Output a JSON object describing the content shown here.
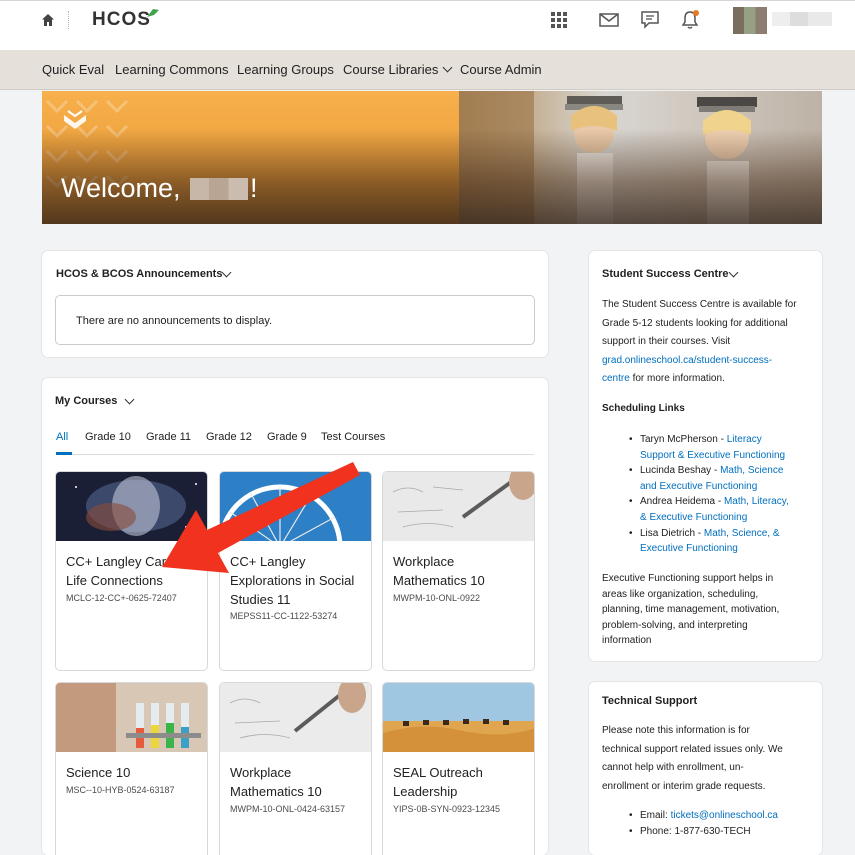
{
  "header": {
    "logo_text": "HCOS",
    "icons": [
      "home-icon",
      "grid-icon",
      "mail-icon",
      "chat-icon",
      "bell-icon"
    ],
    "notification_dot_color": "#e87722"
  },
  "nav": {
    "items": [
      "Quick Eval",
      "Learning Commons",
      "Learning Groups",
      "Course Libraries",
      "Course Admin"
    ]
  },
  "banner": {
    "welcome_prefix": "Welcome, ",
    "welcome_suffix": "!"
  },
  "announcements": {
    "title": "HCOS & BCOS Announcements",
    "empty_text": "There are no announcements to display."
  },
  "my_courses": {
    "title": "My Courses",
    "tabs": [
      "All",
      "Grade 10",
      "Grade 11",
      "Grade 12",
      "Grade 9",
      "Test Courses"
    ],
    "active_tab": "All",
    "courses": [
      {
        "title": "CC+ Langley Career Life Connections",
        "code": "MCLC-12-CC+-0625-72407",
        "image": "galaxy-image"
      },
      {
        "title": "CC+ Langley Explorations in Social Studies 11",
        "code": "MEPSS11-CC-1122-53274",
        "image": "ferris-wheel-image"
      },
      {
        "title": "Workplace Mathematics 10",
        "code": "MWPM-10-ONL-0922",
        "image": "math-worksheet-image"
      },
      {
        "title": "Science 10",
        "code": "MSC--10-HYB-0524-63187",
        "image": "lab-tubes-image"
      },
      {
        "title": "Workplace Mathematics 10",
        "code": "MWPM-10-ONL-0424-63157",
        "image": "math-worksheet-image"
      },
      {
        "title": "SEAL Outreach Leadership",
        "code": "YIPS-0B-SYN-0923-12345",
        "image": "desert-camels-image"
      }
    ]
  },
  "student_success": {
    "title": "Student Success Centre",
    "intro_1": "The Student Success Centre is available for",
    "intro_2": "Grade 5-12 students looking for additional",
    "intro_3": "support in their courses.  Visit",
    "link_1": "grad.onlineschool.ca/student-success-",
    "link_2": "centre",
    "link_suffix": " for more information.",
    "scheduling_title": "Scheduling Links",
    "people": [
      {
        "name": "Taryn McPherson - ",
        "link_a": "Literacy",
        "link_b": "Support & Executive Functioning"
      },
      {
        "name": "Lucinda Beshay - ",
        "link_a": "Math, Science",
        "link_b": "and Executive Functioning"
      },
      {
        "name": "Andrea Heidema - ",
        "link_a": "Math, Literacy,",
        "link_b": "& Executive Functioning"
      },
      {
        "name": "Lisa Dietrich - ",
        "link_a": "Math, Science, &",
        "link_b": "Executive Functioning"
      }
    ],
    "exec_1": "Executive Functioning support helps in",
    "exec_2": "areas like organization, scheduling,",
    "exec_3": "planning, time management, motivation,",
    "exec_4": "problem-solving, and interpreting",
    "exec_5": "information"
  },
  "tech_support": {
    "title": "Technical Support",
    "line_1": "Please note this information is for",
    "line_2": "technical support related issues only. We",
    "line_3": "cannot help with enrollment, un-",
    "line_4": "enrollment or interim grade requests.",
    "email_label": "Email: ",
    "email": "tickets@onlineschool.ca",
    "phone_label": "Phone: 1-877-630-TECH"
  },
  "colors": {
    "link": "#006fbf",
    "nav_bg": "#e6e0da",
    "arrow": "#f0321e",
    "banner_orange": "#f3a945"
  }
}
